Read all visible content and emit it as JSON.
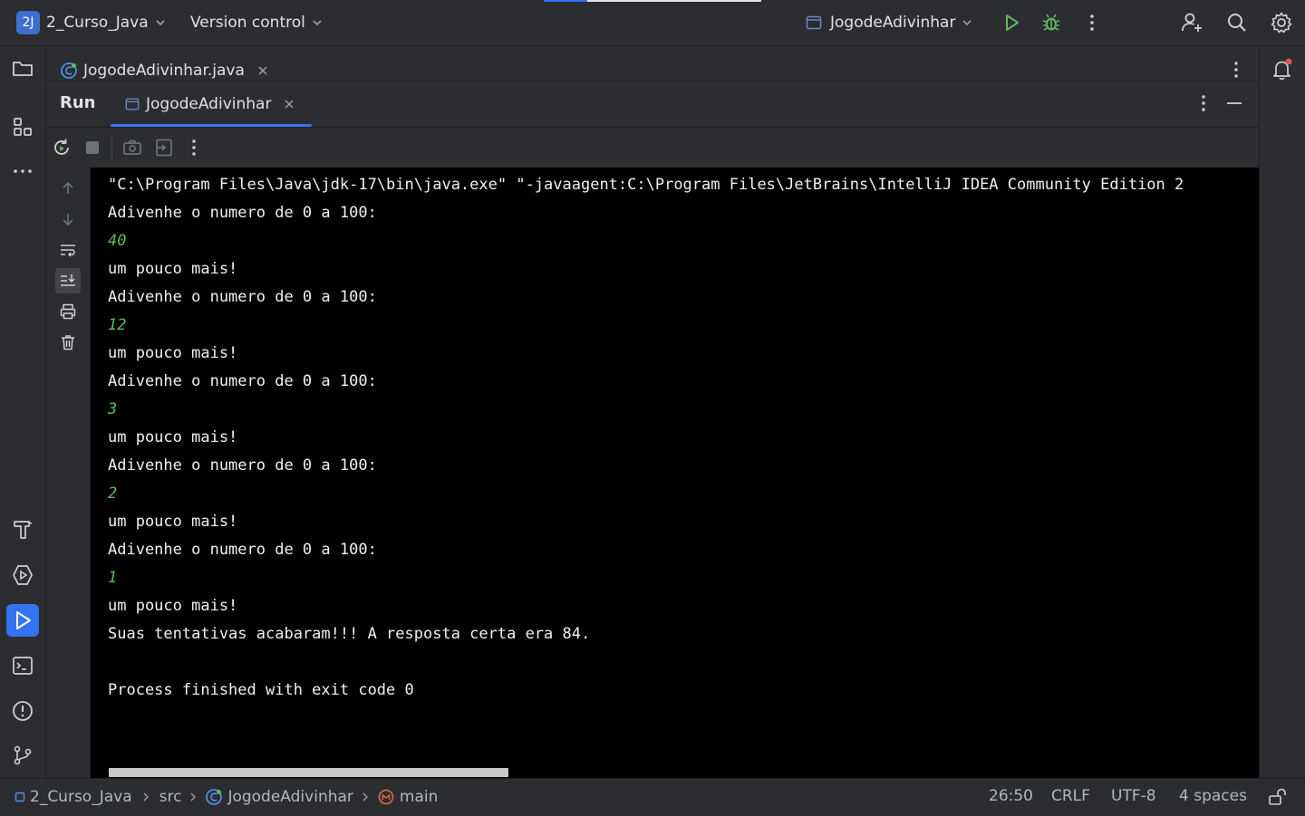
{
  "titlebar": {
    "project_badge": "2J",
    "project_name": "2_Curso_Java",
    "version_control": "Version control",
    "run_config": "JogodeAdivinhar"
  },
  "editor": {
    "tabs": [
      {
        "label": "JogodeAdivinhar.java",
        "icon": "java-class-icon"
      }
    ]
  },
  "run_panel": {
    "title": "Run",
    "tab_label": "JogodeAdivinhar"
  },
  "console": {
    "lines": [
      {
        "text": "\"C:\\Program Files\\Java\\jdk-17\\bin\\java.exe\" \"-javaagent:C:\\Program Files\\JetBrains\\IntelliJ IDEA Community Edition 2",
        "kind": "output"
      },
      {
        "text": "Adivenhe o numero de 0 a 100:",
        "kind": "output"
      },
      {
        "text": "40",
        "kind": "input"
      },
      {
        "text": "um pouco mais!",
        "kind": "output"
      },
      {
        "text": "Adivenhe o numero de 0 a 100:",
        "kind": "output"
      },
      {
        "text": "12",
        "kind": "input"
      },
      {
        "text": "um pouco mais!",
        "kind": "output"
      },
      {
        "text": "Adivenhe o numero de 0 a 100:",
        "kind": "output"
      },
      {
        "text": "3",
        "kind": "input"
      },
      {
        "text": "um pouco mais!",
        "kind": "output"
      },
      {
        "text": "Adivenhe o numero de 0 a 100:",
        "kind": "output"
      },
      {
        "text": "2",
        "kind": "input"
      },
      {
        "text": "um pouco mais!",
        "kind": "output"
      },
      {
        "text": "Adivenhe o numero de 0 a 100:",
        "kind": "output"
      },
      {
        "text": "1",
        "kind": "input"
      },
      {
        "text": "um pouco mais!",
        "kind": "output"
      },
      {
        "text": "Suas tentativas acabaram!!! A resposta certa era 84.",
        "kind": "output"
      },
      {
        "text": "",
        "kind": "output"
      },
      {
        "text": "Process finished with exit code 0",
        "kind": "output"
      }
    ]
  },
  "statusbar": {
    "breadcrumbs": [
      "2_Curso_Java",
      "src",
      "JogodeAdivinhar",
      "main"
    ],
    "position": "26:50",
    "line_ending": "CRLF",
    "encoding": "UTF-8",
    "indent": "4 spaces"
  },
  "colors": {
    "accent": "#3574f0",
    "run_green": "#5fb85f",
    "console_bg": "#000000",
    "ide_bg": "#2b2d30"
  }
}
